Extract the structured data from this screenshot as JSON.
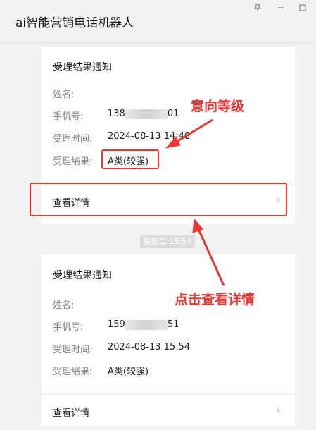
{
  "window": {
    "title": "ai智能营销电话机器人",
    "pin_glyph": "📌",
    "minimize_glyph": "—",
    "close_glyph": "☐"
  },
  "cards": [
    {
      "title": "受理结果通知",
      "name_label": "姓名:",
      "name_value": "",
      "phone_label": "手机号:",
      "phone_prefix": "138",
      "phone_suffix": "01",
      "time_label": "受理时间:",
      "time_value": "2024-08-13 14:48",
      "result_label": "受理结果:",
      "result_value": "A类(较强)",
      "detail_label": "查看详情"
    },
    {
      "title": "受理结果通知",
      "name_label": "姓名:",
      "name_value": "",
      "phone_label": "手机号:",
      "phone_prefix": "159",
      "phone_suffix": "51",
      "time_label": "受理时间:",
      "time_value": "2024-08-13 15:54",
      "result_label": "受理结果:",
      "result_value": "A类(较强)",
      "detail_label": "查看详情"
    }
  ],
  "timestamp": "星期二 15:54",
  "annotations": {
    "level": "意向等级",
    "detail": "点击查看详情",
    "color": "#e53935"
  }
}
